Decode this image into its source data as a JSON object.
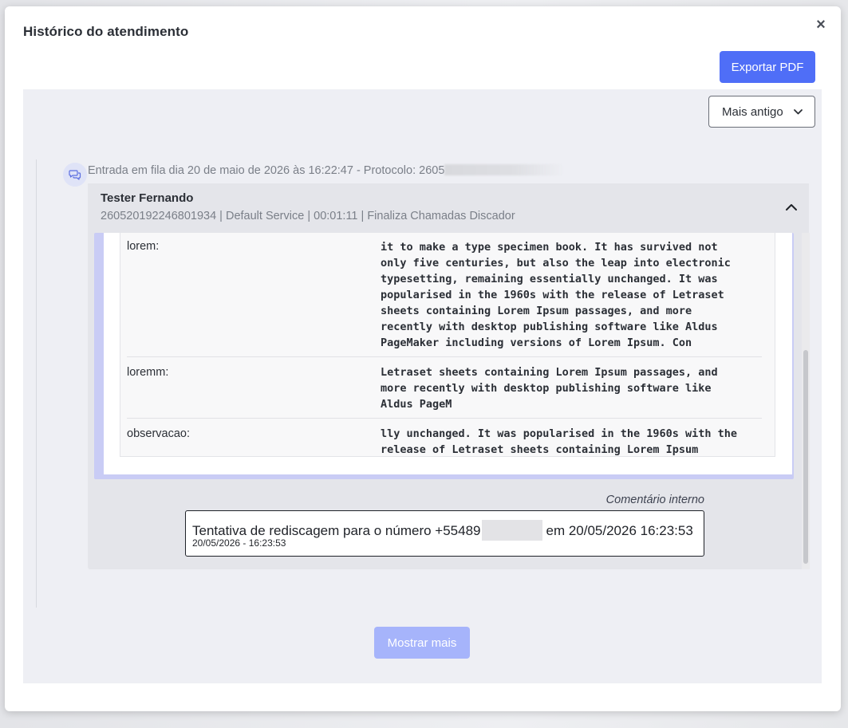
{
  "modal": {
    "title": "Histórico do atendimento",
    "close_glyph": "×"
  },
  "toolbar": {
    "export_label": "Exportar PDF"
  },
  "sort": {
    "selected": "Mais antigo"
  },
  "entry": {
    "header_text": "Entrada em fila dia 20 de maio de 2026 às 16:22:47 - Protocolo: 2605",
    "icon": "chat-bubble-icon"
  },
  "call": {
    "agent": "Tester Fernando",
    "meta": "260520192246801934 | Default Service | 00:01:11 | Finaliza Chamadas Discador"
  },
  "details": [
    {
      "key": "lorem:",
      "value": "it to make a type specimen book. It has survived not\nonly five centuries, but also the leap into electronic\ntypesetting, remaining essentially unchanged. It was\npopularised in the 1960s with the release of Letraset\nsheets containing Lorem Ipsum passages, and more\nrecently with desktop publishing software like Aldus\nPageMaker including versions of Lorem Ipsum. Con"
    },
    {
      "key": "loremm:",
      "value": "Letraset sheets containing Lorem Ipsum passages, and\nmore recently with desktop publishing software like\nAldus PageM"
    },
    {
      "key": "observacao:",
      "value": "lly unchanged. It was popularised in the 1960s with the\nrelease of Letraset sheets containing Lorem Ipsum"
    }
  ],
  "comment": {
    "label": "Comentário interno",
    "text_before": "Tentativa de rediscagem para o número +55489",
    "text_after": "em 20/05/2026 16:23:53",
    "timestamp": "20/05/2026 - 16:23:53"
  },
  "pagination": {
    "more_label": "Mostrar mais"
  },
  "colors": {
    "primary": "#4f6ef7",
    "primary_disabled": "#a6b4fb",
    "panel_bg": "#eeeff4",
    "accent_border": "#c9ccf5"
  }
}
